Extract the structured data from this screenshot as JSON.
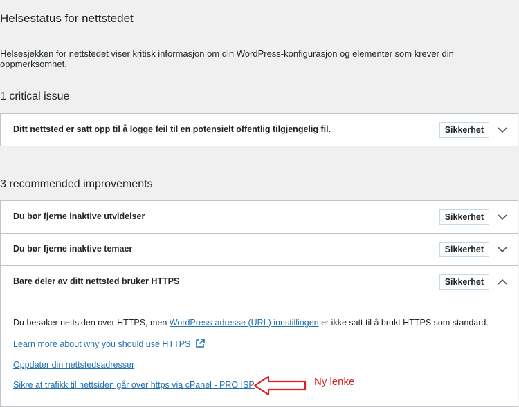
{
  "header": {
    "title": "Helsestatus for nettstedet",
    "description": "Helsesjekken for nettstedet viser kritisk informasjon om din WordPress-konfigurasjon og elementer som krever din oppmerksomhet."
  },
  "critical": {
    "heading": "1 critical issue",
    "items": [
      {
        "label": "Ditt nettsted er satt opp til å logge feil til en potensielt offentlig tilgjengelig fil.",
        "badge": "Sikkerhet"
      }
    ]
  },
  "recommended": {
    "heading": "3 recommended improvements",
    "items": [
      {
        "label": "Du bør fjerne inaktive utvidelser",
        "badge": "Sikkerhet"
      },
      {
        "label": "Du bør fjerne inaktive temaer",
        "badge": "Sikkerhet"
      },
      {
        "label": "Bare deler av ditt nettsted bruker HTTPS",
        "badge": "Sikkerhet"
      }
    ],
    "expanded": {
      "text_before": "Du besøker nettsiden over HTTPS, men ",
      "text_link": "WordPress-adresse (URL) innstillingen",
      "text_after": " er ikke satt til å brukt HTTPS som standard.",
      "link_learn_more": "Learn more about why you should use HTTPS",
      "link_update": "Oppdater din nettstedsadresser",
      "link_new": "Sikre at trafikk til nettsiden går over https via cPanel - PRO ISP"
    }
  },
  "annotation": {
    "text": "Ny lenke",
    "color": "#e02020"
  },
  "colors": {
    "link": "#2271b1",
    "background": "#f0f0f1",
    "badge_border": "#c5d9ed"
  }
}
